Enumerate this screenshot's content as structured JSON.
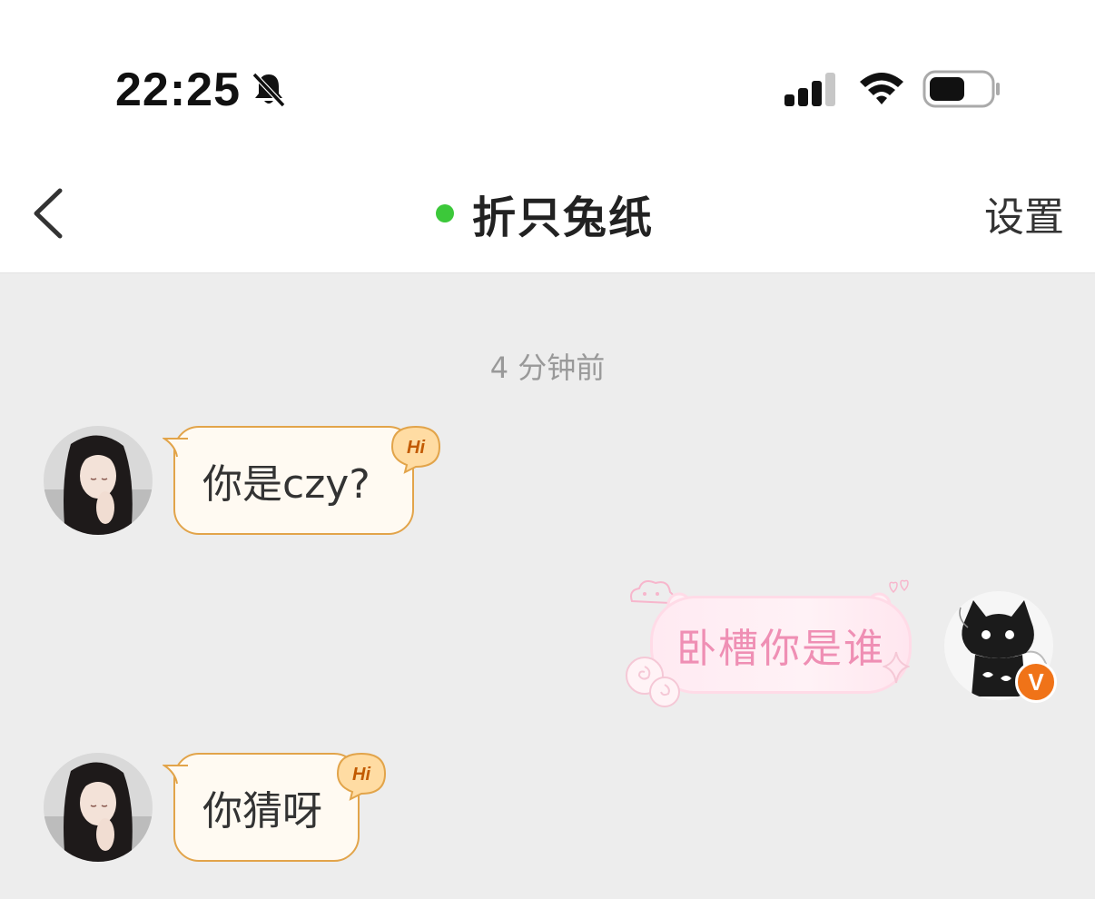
{
  "status_bar": {
    "time": "22:25",
    "icons": [
      "bell-muted-icon",
      "cellular-signal-icon",
      "wifi-icon",
      "battery-icon"
    ]
  },
  "nav": {
    "back_icon": "chevron-left-icon",
    "title": "折只兔纸",
    "online_status_color": "#3cc83a",
    "settings_label": "设置"
  },
  "chat": {
    "timestamp": "4 分钟前",
    "messages": [
      {
        "from": "other",
        "text": "你是czy?",
        "badge": "Hi"
      },
      {
        "from": "me",
        "text": "卧槽你是谁",
        "verified_badge": "V"
      },
      {
        "from": "other",
        "text": "你猜呀",
        "badge": "Hi"
      }
    ]
  },
  "colors": {
    "background": "#ededed",
    "incoming_bubble_fill": "#fffaf2",
    "incoming_bubble_border": "#e2a44a",
    "outgoing_text": "#ef8fb4",
    "verified_badge": "#f07318"
  }
}
